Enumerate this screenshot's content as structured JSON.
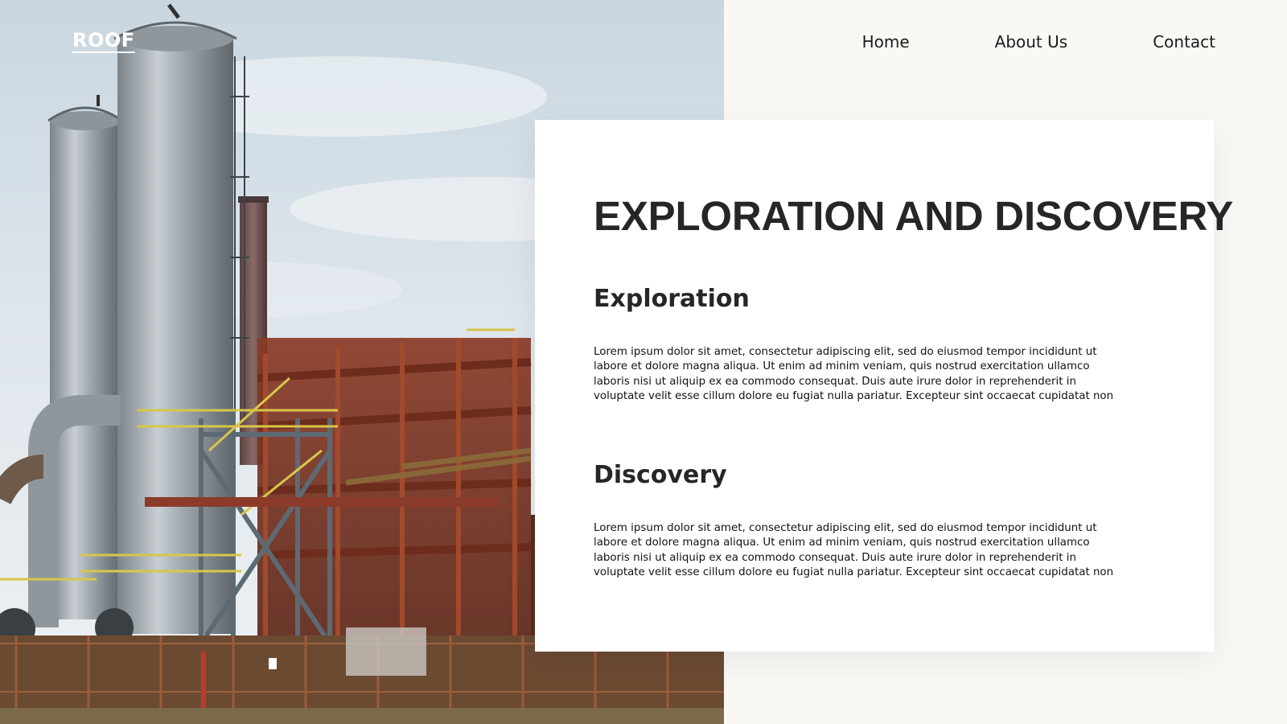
{
  "logo": {
    "text": "ROOF"
  },
  "nav": {
    "items": [
      {
        "label": "Home"
      },
      {
        "label": "About Us"
      },
      {
        "label": "Contact"
      }
    ]
  },
  "card": {
    "title": "EXPLORATION AND DISCOVERY",
    "sections": [
      {
        "heading": "Exploration",
        "body": "Lorem ipsum dolor sit amet, consectetur adipiscing elit, sed do eiusmod tempor incididunt ut labore et dolore magna aliqua. Ut enim ad minim veniam, quis nostrud exercitation ullamco laboris nisi ut aliquip ex ea commodo consequat. Duis aute irure dolor in reprehenderit in voluptate velit esse cillum dolore eu fugiat nulla pariatur. Excepteur sint occaecat cupidatat non"
      },
      {
        "heading": "Discovery",
        "body": "Lorem ipsum dolor sit amet, consectetur adipiscing elit, sed do eiusmod tempor incididunt ut labore et dolore magna aliqua. Ut enim ad minim veniam, quis nostrud exercitation ullamco laboris nisi ut aliquip ex ea commodo consequat. Duis aute irure dolor in reprehenderit in voluptate velit esse cillum dolore eu fugiat nulla pariatur. Excepteur sint occaecat cupidatat non"
      }
    ]
  },
  "colors": {
    "page_background": "#f9f8f4",
    "card_background": "#ffffff",
    "heading_text": "#262626",
    "nav_text": "#1c1c1c",
    "logo_text": "#ffffff"
  },
  "hero_image": {
    "subject": "industrial-plant-photo"
  }
}
